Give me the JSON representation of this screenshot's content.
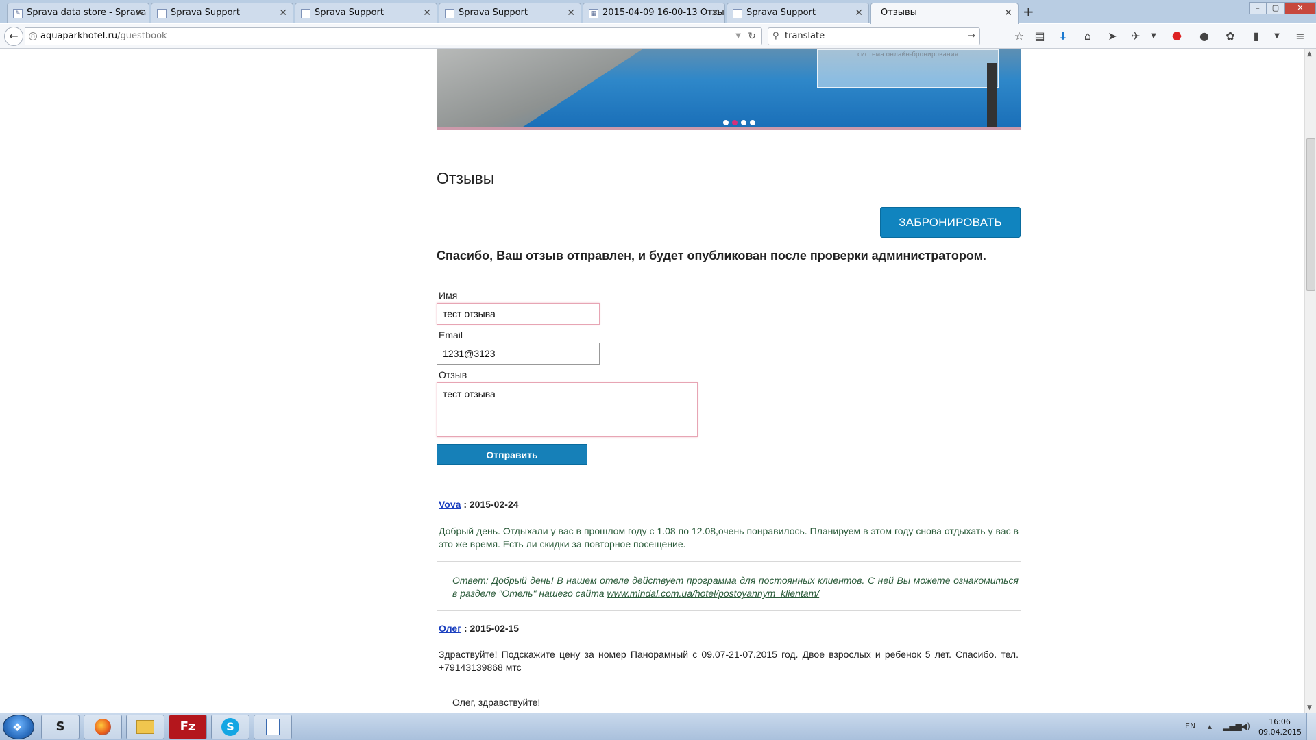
{
  "browser": {
    "tabs": [
      {
        "label": "Sprava data store - Sprava ...",
        "active": false
      },
      {
        "label": "Sprava Support",
        "active": false
      },
      {
        "label": "Sprava Support",
        "active": false
      },
      {
        "label": "Sprava Support",
        "active": false
      },
      {
        "label": "2015-04-09 16-00-13 Отзы...",
        "active": false
      },
      {
        "label": "Sprava Support",
        "active": false
      },
      {
        "label": "Отзывы",
        "active": true
      }
    ],
    "new_tab_label": "+",
    "url_host": "aquaparkhotel.ru",
    "url_path": "/guestbook",
    "search_value": "translate"
  },
  "page": {
    "banner_caption": "система онлайн-бронирования",
    "title": "Отзывы",
    "book_button": "ЗАБРОНИРОВАТЬ",
    "thanks_message": "Спасибо, Ваш отзыв отправлен, и будет опубликован после проверки администратором.",
    "form": {
      "name_label": "Имя",
      "name_value": "тест отзыва",
      "email_label": "Email",
      "email_value": "1231@3123",
      "review_label": "Отзыв",
      "review_value": "тест отзыва",
      "submit_label": "Отправить"
    },
    "reviews": [
      {
        "author": "Vova",
        "date": ": 2015-02-24",
        "text": "Добрый день. Отдыхали у вас в прошлом году с 1.08 по 12.08,очень понравилось. Планируем в этом году снова отдыхать у вас в это же время. Есть ли скидки за повторное посещение.",
        "reply_prefix": "Ответ:  Добрый день! В нашем отеле действует программа для постоянных клиентов. С ней Вы можете ознакомиться в разделе \"Отель\" нашего сайта ",
        "reply_link": "www.mindal.com.ua/hotel/postoyannym_klientam/"
      },
      {
        "author": "Олег",
        "date": ": 2015-02-15",
        "text": "Здраствуйте! Подскажите цену за номер Панорамный с 09.07-21-07.2015 год. Двое взрослых и ребенок 5 лет. Спасибо. тел. +79143139868 мтс",
        "reply_text": "Олег, здравствуйте!"
      }
    ]
  },
  "taskbar": {
    "apps": [
      "S",
      "",
      "",
      "Fz",
      "S",
      ""
    ],
    "lang": "EN",
    "time": "16:06",
    "date": "09.04.2015"
  }
}
